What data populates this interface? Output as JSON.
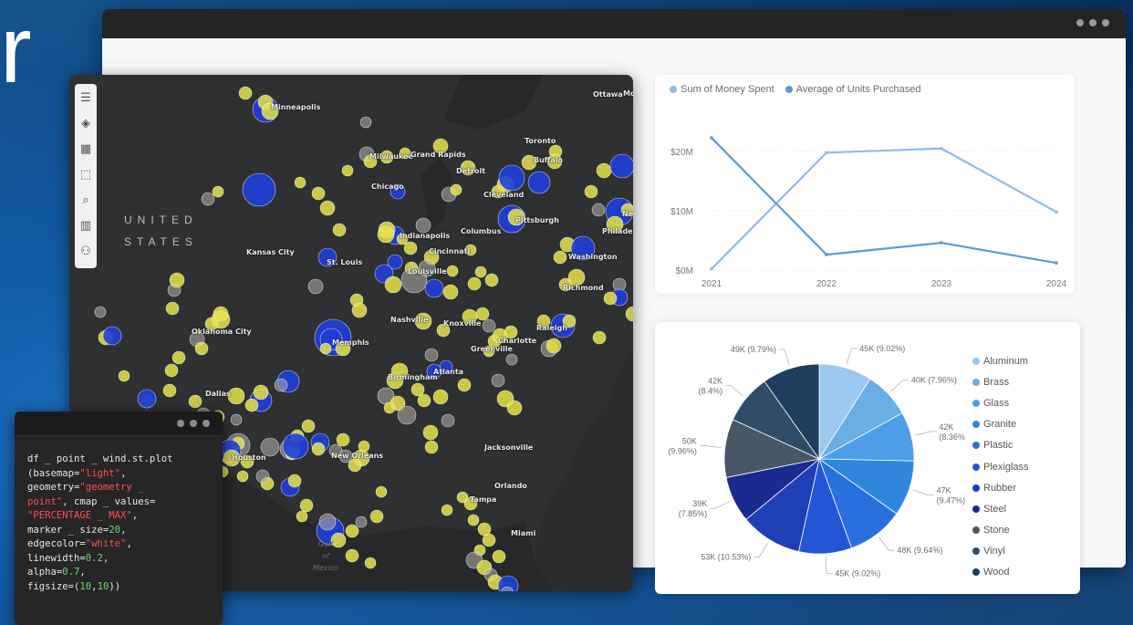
{
  "hero": {
    "letter": "r"
  },
  "map": {
    "country": [
      "UNITED",
      "STATES"
    ],
    "water": [
      "Gulf",
      "of",
      "Mexico"
    ],
    "cities": [
      {
        "name": "Minneapolis",
        "x": 297,
        "y": 118
      },
      {
        "name": "Ottawa",
        "x": 650,
        "y": 104
      },
      {
        "name": "Mon",
        "x": 683,
        "y": 103
      },
      {
        "name": "Toronto",
        "x": 575,
        "y": 155
      },
      {
        "name": "Milwaukee",
        "x": 405,
        "y": 172
      },
      {
        "name": "Grand Rapids",
        "x": 450,
        "y": 170
      },
      {
        "name": "Detroit",
        "x": 500,
        "y": 188
      },
      {
        "name": "Buffalo",
        "x": 585,
        "y": 176
      },
      {
        "name": "Chicago",
        "x": 407,
        "y": 205
      },
      {
        "name": "Cleveland",
        "x": 530,
        "y": 214
      },
      {
        "name": "New York",
        "x": 682,
        "y": 235
      },
      {
        "name": "Pittsburgh",
        "x": 565,
        "y": 242
      },
      {
        "name": "Philadelphia",
        "x": 660,
        "y": 254
      },
      {
        "name": "Columbus",
        "x": 505,
        "y": 254
      },
      {
        "name": "Indianapolis",
        "x": 438,
        "y": 259
      },
      {
        "name": "Cincinnati",
        "x": 470,
        "y": 276
      },
      {
        "name": "Kansas City",
        "x": 270,
        "y": 277
      },
      {
        "name": "Washington",
        "x": 623,
        "y": 282
      },
      {
        "name": "St. Louis",
        "x": 358,
        "y": 288
      },
      {
        "name": "Louisville",
        "x": 447,
        "y": 298
      },
      {
        "name": "Richmond",
        "x": 617,
        "y": 316
      },
      {
        "name": "Nashville",
        "x": 428,
        "y": 351
      },
      {
        "name": "Knoxville",
        "x": 486,
        "y": 355
      },
      {
        "name": "Oklahoma City",
        "x": 210,
        "y": 364
      },
      {
        "name": "Memphis",
        "x": 364,
        "y": 376
      },
      {
        "name": "Charlotte",
        "x": 546,
        "y": 374
      },
      {
        "name": "Greenville",
        "x": 516,
        "y": 383
      },
      {
        "name": "Raleigh",
        "x": 588,
        "y": 360
      },
      {
        "name": "Birmingham",
        "x": 425,
        "y": 414
      },
      {
        "name": "Atlanta",
        "x": 475,
        "y": 408
      },
      {
        "name": "Dallas",
        "x": 225,
        "y": 432
      },
      {
        "name": "Jacksonville",
        "x": 531,
        "y": 491
      },
      {
        "name": "New Orleans",
        "x": 363,
        "y": 500
      },
      {
        "name": "Houston",
        "x": 254,
        "y": 502
      },
      {
        "name": "Orlando",
        "x": 542,
        "y": 533
      },
      {
        "name": "Tampa",
        "x": 515,
        "y": 548
      },
      {
        "name": "Miami",
        "x": 560,
        "y": 585
      }
    ],
    "tools": [
      "menu-icon",
      "layers-icon",
      "basemap-icon",
      "select-icon",
      "search-icon",
      "chart-icon",
      "user-icon"
    ]
  },
  "code": {
    "lines": [
      [
        {
          "t": "df _ point _ wind.st.plot",
          "c": ""
        }
      ],
      [
        {
          "t": "(basemap=",
          "c": ""
        },
        {
          "t": "\"light\"",
          "c": "str"
        },
        {
          "t": ",",
          "c": ""
        }
      ],
      [
        {
          "t": "geometry=",
          "c": ""
        },
        {
          "t": "\"geometry _",
          "c": "str"
        }
      ],
      [
        {
          "t": "point\"",
          "c": "str"
        },
        {
          "t": ", cmap _ values=",
          "c": ""
        }
      ],
      [
        {
          "t": "\"PERCENTAGE _ MAX\"",
          "c": "str"
        },
        {
          "t": ",",
          "c": ""
        }
      ],
      [
        {
          "t": "marker _ size=",
          "c": ""
        },
        {
          "t": "20",
          "c": "num"
        },
        {
          "t": ",",
          "c": ""
        }
      ],
      [
        {
          "t": "edgecolor=",
          "c": ""
        },
        {
          "t": "\"white\"",
          "c": "str"
        },
        {
          "t": ",",
          "c": ""
        }
      ],
      [
        {
          "t": "linewidth=",
          "c": ""
        },
        {
          "t": "0.2",
          "c": "num"
        },
        {
          "t": ",",
          "c": ""
        }
      ],
      [
        {
          "t": "alpha=",
          "c": ""
        },
        {
          "t": "0.7",
          "c": "num"
        },
        {
          "t": ",",
          "c": ""
        }
      ],
      [
        {
          "t": "figsize=(",
          "c": ""
        },
        {
          "t": "10",
          "c": "num"
        },
        {
          "t": ",",
          "c": ""
        },
        {
          "t": "10",
          "c": "num"
        },
        {
          "t": "))",
          "c": ""
        }
      ]
    ]
  },
  "colors": {
    "line_money": "#8fbbe6",
    "line_units": "#5b9bd5"
  },
  "chart_data": [
    {
      "type": "line",
      "x": [
        "2021",
        "2022",
        "2023",
        "2024"
      ],
      "series": [
        {
          "name": "Sum of Money Spent",
          "values": [
            0.2,
            19.8,
            20.5,
            9.8
          ],
          "color": "#8fbbe6"
        },
        {
          "name": "Average of Units Purchased",
          "values": [
            22.3,
            2.6,
            4.6,
            1.2
          ],
          "color": "#5b9bd5"
        }
      ],
      "yticks": [
        "$0M",
        "$10M",
        "$20M"
      ],
      "ytick_values": [
        0,
        10,
        20
      ],
      "ylim": [
        0,
        24
      ],
      "grid": true,
      "legend": "top-left"
    },
    {
      "type": "pie",
      "slices": [
        {
          "name": "Aluminum",
          "label": "45K (9.02%)",
          "value": 9.02,
          "color": "#9cc7ef"
        },
        {
          "name": "Brass",
          "label": "40K (7.96%)",
          "value": 7.96,
          "color": "#6aaee8"
        },
        {
          "name": "Glass",
          "label": "42K (8.36%)",
          "value": 8.36,
          "color": "#4d9ee6"
        },
        {
          "name": "Granite",
          "label": "47K (9.47%)",
          "value": 9.47,
          "color": "#2e86de"
        },
        {
          "name": "Plastic",
          "label": "48K (9.64%)",
          "value": 9.64,
          "color": "#2a6fde"
        },
        {
          "name": "Plexiglass",
          "label": "45K (9.02%)",
          "value": 9.02,
          "color": "#2256d6"
        },
        {
          "name": "Rubber",
          "label": "53K (10.53%)",
          "value": 10.53,
          "color": "#1d3fb8"
        },
        {
          "name": "Steel",
          "label": "39K (7.85%)",
          "value": 7.85,
          "color": "#1a2a8f"
        },
        {
          "name": "Stone",
          "label": "50K (9.96%)",
          "value": 9.96,
          "color": "#4a5566"
        },
        {
          "name": "Vinyl",
          "label": "42K (8.4%)",
          "value": 8.4,
          "color": "#2f4d69"
        },
        {
          "name": "Wood",
          "label": "49K (9.79%)",
          "value": 9.79,
          "color": "#1f3d5e"
        }
      ],
      "legend": "right"
    }
  ]
}
